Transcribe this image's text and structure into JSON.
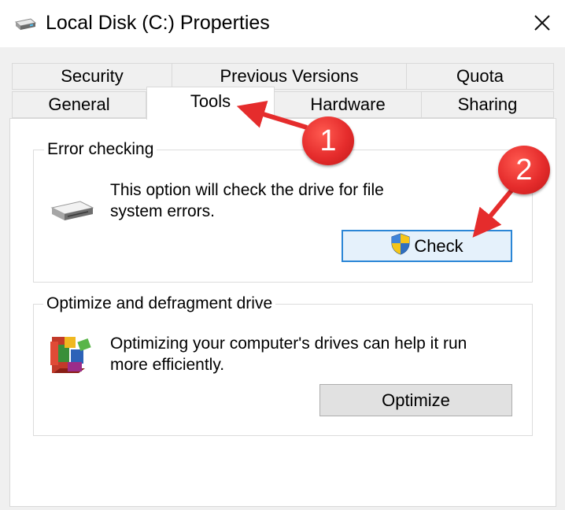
{
  "window": {
    "title": "Local Disk (C:) Properties",
    "icon": "drive-icon",
    "close_icon": "close-icon"
  },
  "tabs": {
    "row1": [
      {
        "label": "Security"
      },
      {
        "label": "Previous Versions"
      },
      {
        "label": "Quota"
      }
    ],
    "row2": [
      {
        "label": "General"
      },
      {
        "label": "Tools",
        "active": true
      },
      {
        "label": "Hardware"
      },
      {
        "label": "Sharing"
      }
    ]
  },
  "error_checking": {
    "group_label": "Error checking",
    "description_line1": "This option will check the drive for file",
    "description_line2": "system errors.",
    "button_label": "Check",
    "button_icon": "uac-shield-icon"
  },
  "optimize": {
    "group_label": "Optimize and defragment drive",
    "description_line1": "Optimizing your computer's drives can help it run",
    "description_line2": "more efficiently.",
    "button_label": "Optimize",
    "icon": "defrag-icon"
  },
  "annotations": [
    {
      "number": "1"
    },
    {
      "number": "2"
    }
  ],
  "colors": {
    "dialog_bg": "#f0f0f0",
    "panel_bg": "#ffffff",
    "accent_border": "#2b86d6",
    "annotation_red": "#e52c2c"
  }
}
